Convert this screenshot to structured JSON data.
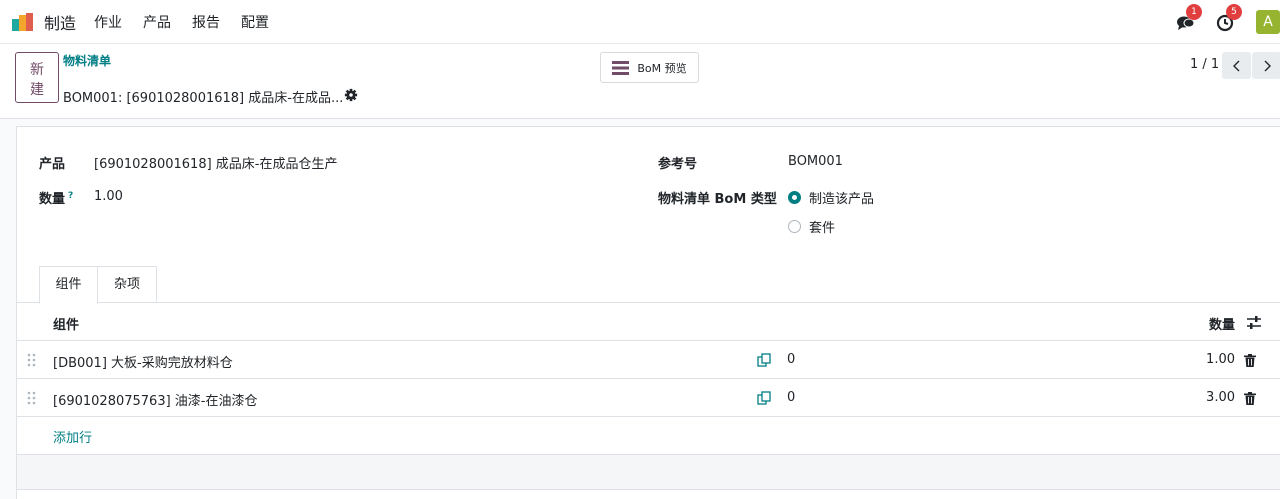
{
  "navbar": {
    "app_name": "制造",
    "menu": [
      "作业",
      "产品",
      "报告",
      "配置"
    ],
    "messages_count": "1",
    "activities_count": "5",
    "avatar_letter": "A",
    "colors": {
      "accent": "#017e84",
      "primary": "#714b67",
      "badge": "#e13f3f",
      "avatar": "#96b42f"
    }
  },
  "control": {
    "new_label": "新建",
    "new_label_line1": "新",
    "new_label_line2": "建",
    "breadcrumb": "物料清单",
    "record_title": "BOM001: [6901028001618] 成品床-在成品...",
    "preview_label": "BoM 预览",
    "pager": "1 / 1"
  },
  "form": {
    "product_label": "产品",
    "product_value": "[6901028001618] 成品床-在成品仓生产",
    "quantity_label": "数量",
    "quantity_help": "?",
    "quantity_value": "1.00",
    "reference_label": "参考号",
    "reference_value": "BOM001",
    "bom_type_label": "物料清单 BoM 类型",
    "bom_type_options": [
      {
        "label": "制造该产品",
        "selected": true
      },
      {
        "label": "套件",
        "selected": false
      }
    ]
  },
  "tabs": [
    {
      "label": "组件",
      "active": true
    },
    {
      "label": "杂项",
      "active": false
    }
  ],
  "components_table": {
    "headers": {
      "component": "组件",
      "quantity": "数量"
    },
    "rows": [
      {
        "component": "[DB001] 大板-采购完放材料仓",
        "available": "0",
        "quantity": "1.00"
      },
      {
        "component": "[6901028075763] 油漆-在油漆仓",
        "available": "0",
        "quantity": "3.00"
      }
    ],
    "add_line_label": "添加行"
  }
}
